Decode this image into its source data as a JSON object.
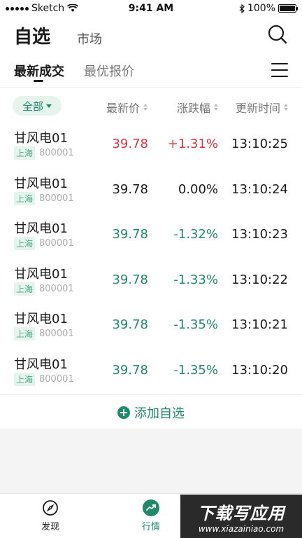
{
  "status_bar": {
    "carrier": "Sketch",
    "time": "9:41 AM",
    "battery": "100%",
    "battery_level": 1.0
  },
  "header": {
    "title": "自选",
    "market_tab": "市场",
    "subtabs": {
      "latest": "最新成交",
      "best": "最优报价"
    }
  },
  "columns": {
    "filter": "全部",
    "price": "最新价",
    "change": "涨跌幅",
    "time": "更新时间"
  },
  "rows": [
    {
      "name": "甘风电01",
      "market": "上海",
      "code": "800001",
      "price": "39.78",
      "change": "+1.31%",
      "time": "13:10:25",
      "trend": "up"
    },
    {
      "name": "甘风电01",
      "market": "上海",
      "code": "800001",
      "price": "39.78",
      "change": "0.00%",
      "time": "13:10:24",
      "trend": "flat"
    },
    {
      "name": "甘风电01",
      "market": "上海",
      "code": "800001",
      "price": "39.78",
      "change": "-1.32%",
      "time": "13:10:23",
      "trend": "down"
    },
    {
      "name": "甘风电01",
      "market": "上海",
      "code": "800001",
      "price": "39.78",
      "change": "-1.33%",
      "time": "13:10:22",
      "trend": "down"
    },
    {
      "name": "甘风电01",
      "market": "上海",
      "code": "800001",
      "price": "39.78",
      "change": "-1.35%",
      "time": "13:10:21",
      "trend": "down"
    },
    {
      "name": "甘风电01",
      "market": "上海",
      "code": "800001",
      "price": "39.78",
      "change": "-1.35%",
      "time": "13:10:20",
      "trend": "down"
    }
  ],
  "add_watchlist": "添加自选",
  "tabbar": {
    "discover": "发现",
    "market": "行情"
  },
  "watermark": {
    "title": "下载写应用",
    "url": "www.xiazainiao.com"
  },
  "colors": {
    "accent": "#1e8a6a",
    "up": "#d9343f",
    "down": "#1e8a6a",
    "flat": "#1a1a1a"
  },
  "icons": {
    "search": "search-icon",
    "menu": "menu-icon",
    "compass": "compass-icon",
    "trend": "trend-up-icon",
    "add": "plus-circle-icon"
  }
}
